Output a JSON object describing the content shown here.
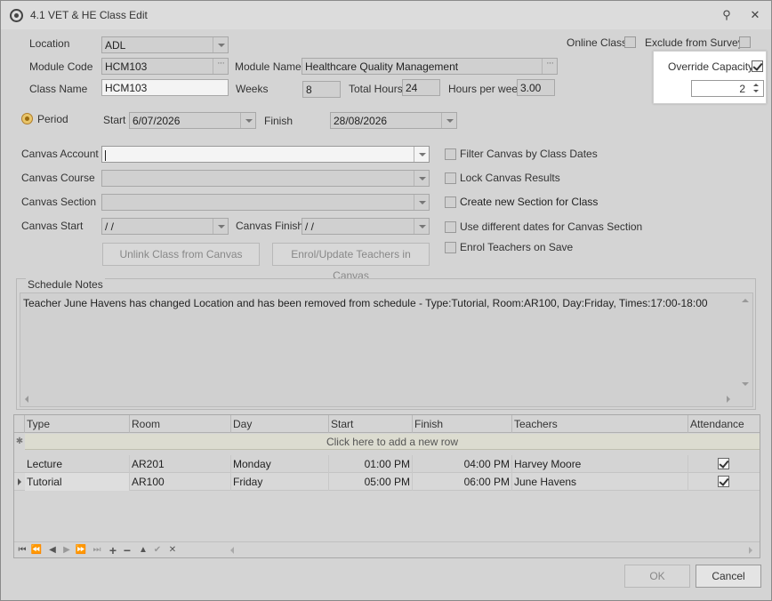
{
  "window": {
    "title": "4.1 VET & HE Class Edit"
  },
  "form": {
    "location_label": "Location",
    "location_value": "ADL",
    "online_class_label": "Online Class",
    "exclude_survey_label": "Exclude from Survey",
    "module_code_label": "Module Code",
    "module_code_value": "HCM103",
    "module_name_label": "Module Name",
    "module_name_value": "Healthcare Quality Management",
    "class_name_label": "Class Name",
    "class_name_value": "HCM103",
    "weeks_label": "Weeks",
    "weeks_value": "8",
    "total_hours_label": "Total Hours",
    "total_hours_value": "24",
    "hours_per_week_label": "Hours per week",
    "hours_per_week_value": "3.00",
    "override_capacity_label": "Override Capacity",
    "override_capacity_checked": true,
    "capacity_value": "2",
    "period_label": "Period",
    "start_label": "Start",
    "start_value": "6/07/2026",
    "finish_label": "Finish",
    "finish_value": "28/08/2026"
  },
  "canvas": {
    "account_label": "Canvas Account",
    "account_value": "",
    "course_label": "Canvas Course",
    "section_label": "Canvas Section",
    "start_label": "Canvas Start",
    "start_value": " / /",
    "finish_label": "Canvas Finish",
    "finish_value": " / /",
    "filter_label": "Filter Canvas by Class Dates",
    "lock_label": "Lock Canvas Results",
    "create_section_label": "Create new Section for Class",
    "different_dates_label": "Use different dates for Canvas Section",
    "enrol_label": "Enrol Teachers on Save",
    "unlink_button": "Unlink Class from Canvas",
    "enrol_update_button": "Enrol/Update Teachers in Canvas"
  },
  "schedule_notes": {
    "title": "Schedule Notes",
    "text": "Teacher June Havens has changed Location and has been removed from schedule - Type:Tutorial, Room:AR100, Day:Friday, Times:17:00-18:00"
  },
  "grid": {
    "columns": [
      "Type",
      "Room",
      "Day",
      "Start",
      "Finish",
      "Teachers",
      "Attendance"
    ],
    "new_row_text": "Click here to add a new row",
    "rows": [
      {
        "type": "Lecture",
        "room": "AR201",
        "day": "Monday",
        "start": "01:00 PM",
        "finish": "04:00 PM",
        "teachers": "Harvey Moore",
        "attendance": true
      },
      {
        "type": "Tutorial",
        "room": "AR100",
        "day": "Friday",
        "start": "05:00 PM",
        "finish": "06:00 PM",
        "teachers": "June Havens",
        "attendance": true
      }
    ]
  },
  "footer": {
    "ok_label": "OK",
    "cancel_label": "Cancel"
  }
}
